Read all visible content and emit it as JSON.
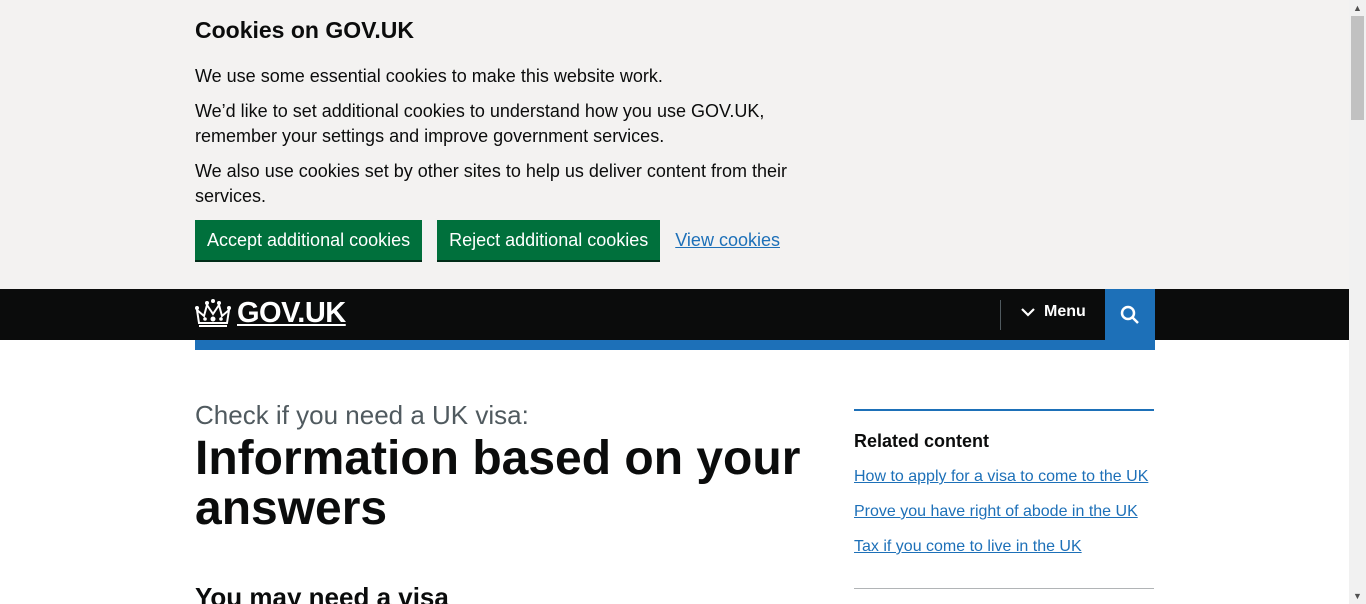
{
  "cookie_banner": {
    "title": "Cookies on GOV.UK",
    "paragraphs": [
      "We use some essential cookies to make this website work.",
      "We’d like to set additional cookies to understand how you use GOV.UK, remember your settings and improve government services.",
      "We also use cookies set by other sites to help us deliver content from their services."
    ],
    "accept_label": "Accept additional cookies",
    "reject_label": "Reject additional cookies",
    "view_label": "View cookies"
  },
  "header": {
    "logo_text": "GOV.UK",
    "menu_label": "Menu",
    "search_icon": "search-icon",
    "crown_icon": "crown-icon"
  },
  "main": {
    "caption": "Check if you need a UK visa:",
    "title": "Information based on your answers",
    "subheading": "You may need a visa"
  },
  "related": {
    "title": "Related content",
    "links": [
      "How to apply for a visa to come to the UK",
      "Prove you have right of abode in the UK",
      "Tax if you come to live in the UK"
    ]
  },
  "colors": {
    "button_green": "#00703c",
    "link_blue": "#1d70b8",
    "header_black": "#0b0c0c",
    "banner_grey": "#f3f2f1"
  }
}
